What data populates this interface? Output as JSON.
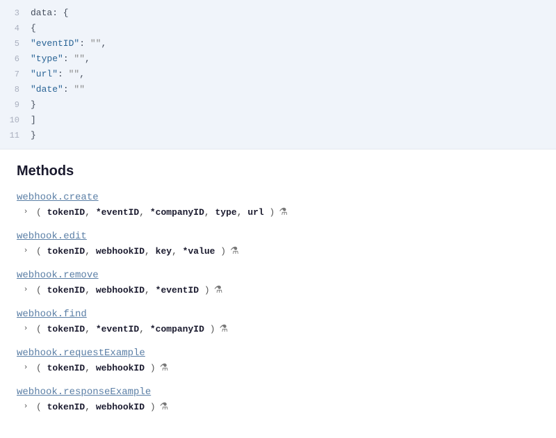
{
  "code": {
    "lines": [
      {
        "num": "3",
        "content": "data: {"
      },
      {
        "num": "4",
        "content": "    {"
      },
      {
        "num": "5",
        "content": "        \"eventID\": \"\","
      },
      {
        "num": "6",
        "content": "        \"type\": \"\","
      },
      {
        "num": "7",
        "content": "        \"url\": \"\","
      },
      {
        "num": "8",
        "content": "        \"date\": \"\""
      },
      {
        "num": "9",
        "content": "    }"
      },
      {
        "num": "10",
        "content": "]"
      },
      {
        "num": "11",
        "content": "}"
      }
    ]
  },
  "section": {
    "title": "Methods"
  },
  "methods": [
    {
      "name": "webhook.create",
      "params_display": "( tokenID, *eventID, *companyID, type, url )",
      "params": [
        {
          "text": "tokenID",
          "bold": true,
          "star": false
        },
        {
          "text": ", ",
          "bold": false
        },
        {
          "text": "*eventID",
          "bold": true,
          "star": true
        },
        {
          "text": ", ",
          "bold": false
        },
        {
          "text": "*companyID",
          "bold": true,
          "star": true
        },
        {
          "text": ", ",
          "bold": false
        },
        {
          "text": "type",
          "bold": true,
          "star": false
        },
        {
          "text": ", ",
          "bold": false
        },
        {
          "text": "url",
          "bold": true,
          "star": false
        }
      ],
      "has_beaker": true
    },
    {
      "name": "webhook.edit",
      "params": [
        {
          "text": "tokenID",
          "bold": true,
          "star": false
        },
        {
          "text": ", ",
          "bold": false
        },
        {
          "text": "webhookID",
          "bold": true,
          "star": false
        },
        {
          "text": ", ",
          "bold": false
        },
        {
          "text": "key",
          "bold": true,
          "star": false
        },
        {
          "text": ", ",
          "bold": false
        },
        {
          "text": "*value",
          "bold": true,
          "star": true
        }
      ],
      "has_beaker": true
    },
    {
      "name": "webhook.remove",
      "params": [
        {
          "text": "tokenID",
          "bold": true,
          "star": false
        },
        {
          "text": ", ",
          "bold": false
        },
        {
          "text": "webhookID",
          "bold": true,
          "star": false
        },
        {
          "text": ", ",
          "bold": false
        },
        {
          "text": "*eventID",
          "bold": true,
          "star": true
        }
      ],
      "has_beaker": true
    },
    {
      "name": "webhook.find",
      "params": [
        {
          "text": "tokenID",
          "bold": true,
          "star": false
        },
        {
          "text": ", ",
          "bold": false
        },
        {
          "text": "*eventID",
          "bold": true,
          "star": true
        },
        {
          "text": ", ",
          "bold": false
        },
        {
          "text": "*companyID",
          "bold": true,
          "star": true
        }
      ],
      "has_beaker": true
    },
    {
      "name": "webhook.requestExample",
      "params": [
        {
          "text": "tokenID",
          "bold": true,
          "star": false
        },
        {
          "text": ", ",
          "bold": false
        },
        {
          "text": "webhookID",
          "bold": true,
          "star": false
        }
      ],
      "has_beaker": true
    },
    {
      "name": "webhook.responseExample",
      "params": [
        {
          "text": "tokenID",
          "bold": true,
          "star": false
        },
        {
          "text": ", ",
          "bold": false
        },
        {
          "text": "webhookID",
          "bold": true,
          "star": false
        }
      ],
      "has_beaker": true
    }
  ],
  "icons": {
    "chevron": "›",
    "beaker": "🧪"
  }
}
